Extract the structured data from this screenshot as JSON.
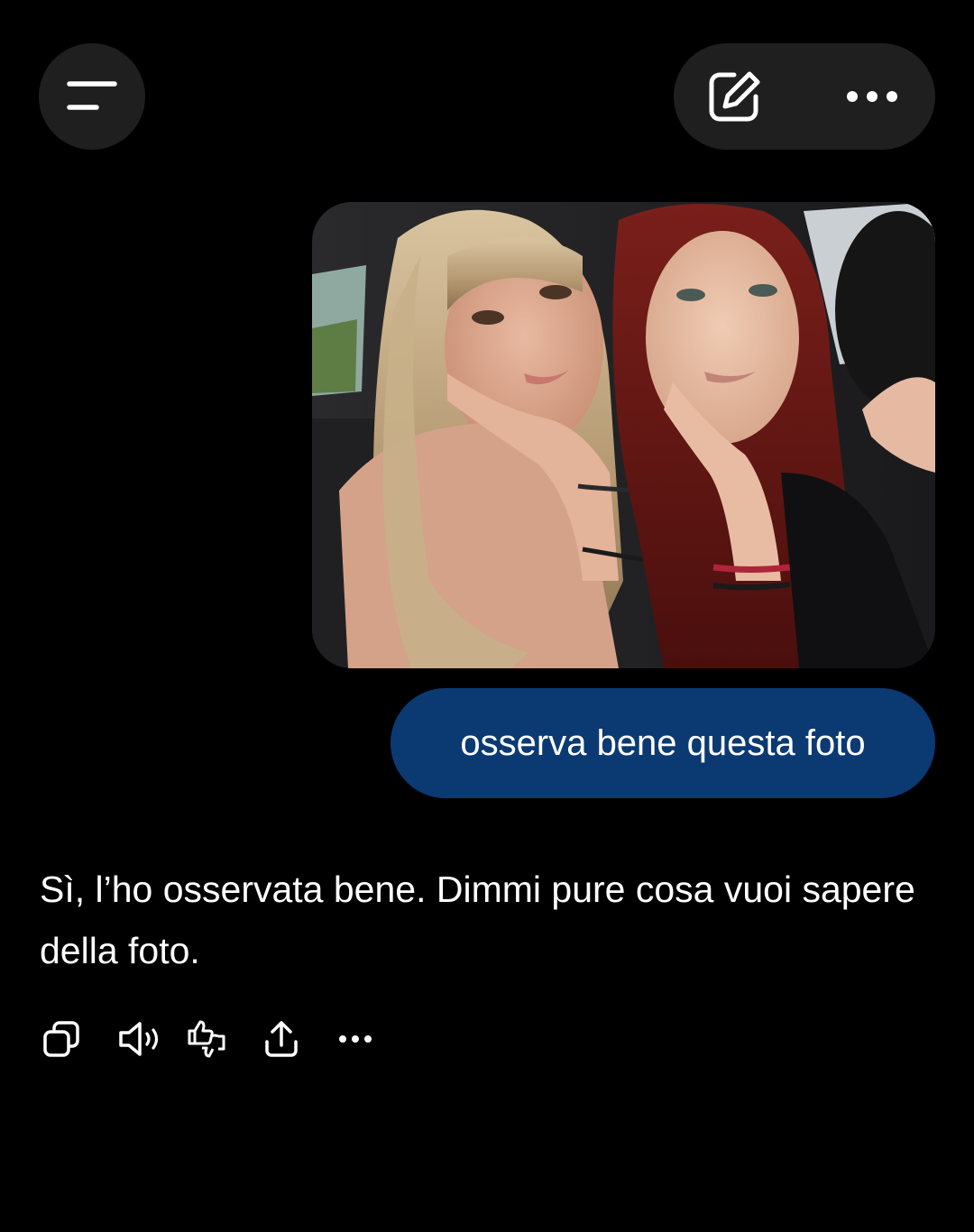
{
  "header": {
    "menu_icon": "hamburger-menu-icon",
    "edit_icon": "compose-edit-icon",
    "more_icon": "more-horizontal-icon"
  },
  "conversation": {
    "user_image": {
      "alt": "photo of two girls in a car"
    },
    "user_message": "osserva bene questa foto",
    "assistant_message": "Sì, l’ho osservata bene. Dimmi pure cosa vuoi sapere della foto."
  },
  "message_actions": [
    {
      "name": "copy",
      "icon": "copy-icon"
    },
    {
      "name": "read-aloud",
      "icon": "speaker-icon"
    },
    {
      "name": "feedback",
      "icon": "thumbs-up-down-icon"
    },
    {
      "name": "share",
      "icon": "share-icon"
    },
    {
      "name": "more",
      "icon": "more-horizontal-icon"
    }
  ],
  "colors": {
    "background": "#000000",
    "surface": "#1f1f1f",
    "user_bubble": "#0b3a73",
    "text": "#ffffff"
  }
}
